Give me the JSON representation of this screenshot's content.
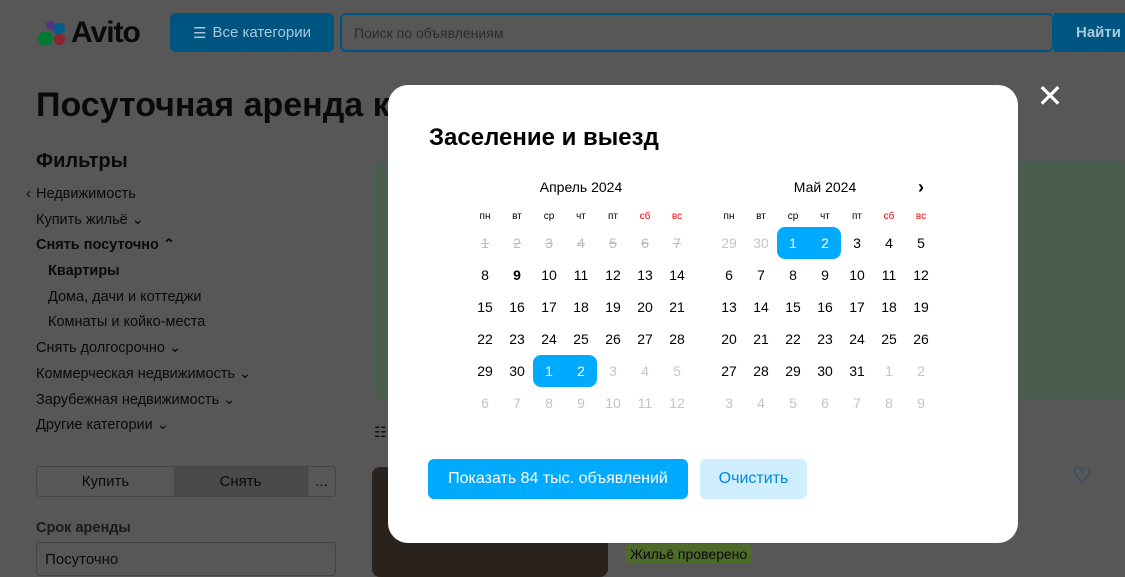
{
  "header": {
    "logo": "Avito",
    "categories_label": "Все категории",
    "search_placeholder": "Поиск по объявлениям",
    "find_label": "Найти"
  },
  "page": {
    "title": "Посуточная аренда квартир"
  },
  "sidebar": {
    "filters_title": "Фильтры",
    "items": [
      {
        "label": "Недвижимость",
        "icon": "chevron-left-icon"
      },
      {
        "label": "Купить жильё ⌄"
      },
      {
        "label": "Снять посуточно ⌃",
        "bold": true
      },
      {
        "label": "Квартиры",
        "bold": true,
        "sub": true
      },
      {
        "label": "Дома, дачи и коттеджи",
        "sub": true
      },
      {
        "label": "Комнаты и койко-места",
        "sub": true
      },
      {
        "label": "Снять долгосрочно ⌄"
      },
      {
        "label": "Коммерческая недвижимость ⌄"
      },
      {
        "label": "Зарубежная недвижимость ⌄"
      },
      {
        "label": "Другие категории ⌄"
      }
    ],
    "segment": [
      "Купить",
      "Снять",
      "..."
    ],
    "rent_term_label": "Срок аренды",
    "rent_term_value": "Посуточно"
  },
  "listing": {
    "badge": "Жильё проверено"
  },
  "modal": {
    "title": "Заселение и выезд",
    "show_label": "Показать 84 тыс. объявлений",
    "clear_label": "Очистить",
    "weekdays": [
      "пн",
      "вт",
      "ср",
      "чт",
      "пт",
      "сб",
      "вс"
    ],
    "months": [
      {
        "name": "Апрель 2024",
        "days": [
          [
            1,
            "past"
          ],
          [
            2,
            "past"
          ],
          [
            3,
            "past"
          ],
          [
            4,
            "past"
          ],
          [
            5,
            "past"
          ],
          [
            6,
            "past"
          ],
          [
            7,
            "past"
          ],
          [
            8,
            ""
          ],
          [
            9,
            "today"
          ],
          [
            10,
            ""
          ],
          [
            11,
            ""
          ],
          [
            12,
            ""
          ],
          [
            13,
            ""
          ],
          [
            14,
            ""
          ],
          [
            15,
            ""
          ],
          [
            16,
            ""
          ],
          [
            17,
            ""
          ],
          [
            18,
            ""
          ],
          [
            19,
            ""
          ],
          [
            20,
            ""
          ],
          [
            21,
            ""
          ],
          [
            22,
            ""
          ],
          [
            23,
            ""
          ],
          [
            24,
            ""
          ],
          [
            25,
            ""
          ],
          [
            26,
            ""
          ],
          [
            27,
            ""
          ],
          [
            28,
            ""
          ],
          [
            29,
            ""
          ],
          [
            30,
            ""
          ],
          [
            1,
            "sel sel-start"
          ],
          [
            2,
            "sel sel-end"
          ],
          [
            3,
            "other"
          ],
          [
            4,
            "other"
          ],
          [
            5,
            "other"
          ],
          [
            6,
            "other"
          ],
          [
            7,
            "other"
          ],
          [
            8,
            "other"
          ],
          [
            9,
            "other"
          ],
          [
            10,
            "other"
          ],
          [
            11,
            "other"
          ],
          [
            12,
            "other"
          ]
        ]
      },
      {
        "name": "Май 2024",
        "days": [
          [
            29,
            "other"
          ],
          [
            30,
            "other"
          ],
          [
            1,
            "sel sel-start"
          ],
          [
            2,
            "sel sel-end"
          ],
          [
            3,
            ""
          ],
          [
            4,
            ""
          ],
          [
            5,
            ""
          ],
          [
            6,
            ""
          ],
          [
            7,
            ""
          ],
          [
            8,
            ""
          ],
          [
            9,
            ""
          ],
          [
            10,
            ""
          ],
          [
            11,
            ""
          ],
          [
            12,
            ""
          ],
          [
            13,
            ""
          ],
          [
            14,
            ""
          ],
          [
            15,
            ""
          ],
          [
            16,
            ""
          ],
          [
            17,
            ""
          ],
          [
            18,
            ""
          ],
          [
            19,
            ""
          ],
          [
            20,
            ""
          ],
          [
            21,
            ""
          ],
          [
            22,
            ""
          ],
          [
            23,
            ""
          ],
          [
            24,
            ""
          ],
          [
            25,
            ""
          ],
          [
            26,
            ""
          ],
          [
            27,
            ""
          ],
          [
            28,
            ""
          ],
          [
            29,
            ""
          ],
          [
            30,
            ""
          ],
          [
            31,
            ""
          ],
          [
            1,
            "other"
          ],
          [
            2,
            "other"
          ],
          [
            3,
            "other"
          ],
          [
            4,
            "other"
          ],
          [
            5,
            "other"
          ],
          [
            6,
            "other"
          ],
          [
            7,
            "other"
          ],
          [
            8,
            "other"
          ],
          [
            9,
            "other"
          ]
        ]
      }
    ]
  }
}
